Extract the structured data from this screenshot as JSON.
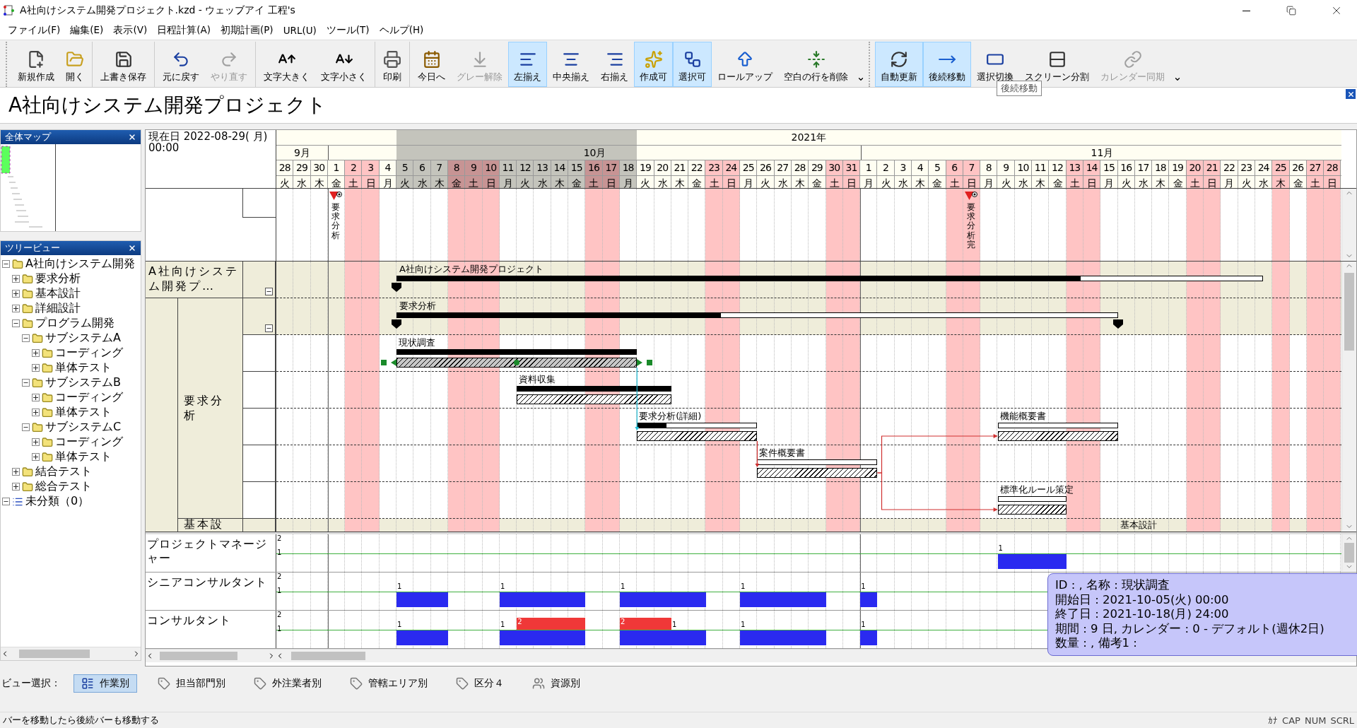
{
  "window": {
    "title": "A社向けシステム開発プロジェクト.kzd - ウェッブアイ 工程's"
  },
  "menu": [
    "ファイル(F)",
    "編集(E)",
    "表示(V)",
    "日程計算(A)",
    "初期計画(P)",
    "URL(U)",
    "ツール(T)",
    "ヘルプ(H)"
  ],
  "toolbars": [
    {
      "more": true,
      "groups": [
        [
          {
            "label": "新規作成",
            "disabled": false,
            "selected": false
          },
          {
            "label": "開く",
            "disabled": false,
            "selected": false
          }
        ],
        [
          {
            "label": "上書き保存",
            "disabled": false,
            "selected": false
          }
        ],
        [
          {
            "label": "元に戻す",
            "disabled": false,
            "selected": false
          },
          {
            "label": "やり直す",
            "disabled": true,
            "selected": false
          }
        ],
        [
          {
            "label": "文字大きく",
            "disabled": false,
            "selected": false
          },
          {
            "label": "文字小さく",
            "disabled": false,
            "selected": false
          }
        ],
        [
          {
            "label": "印刷",
            "disabled": false,
            "selected": false
          }
        ],
        [
          {
            "label": "今日へ",
            "disabled": false,
            "selected": false
          },
          {
            "label": "グレー解除",
            "disabled": true,
            "selected": false
          },
          {
            "label": "左揃え",
            "disabled": false,
            "selected": true
          },
          {
            "label": "中央揃え",
            "disabled": false,
            "selected": false
          },
          {
            "label": "右揃え",
            "disabled": false,
            "selected": false
          },
          {
            "label": "作成可",
            "disabled": false,
            "selected": true
          },
          {
            "label": "選択可",
            "disabled": false,
            "selected": true
          },
          {
            "label": "ロールアップ",
            "disabled": false,
            "selected": false
          },
          {
            "label": "空白の行を削除",
            "disabled": false,
            "selected": false
          }
        ]
      ]
    },
    {
      "more": true,
      "groups": [
        [
          {
            "label": "自動更新",
            "disabled": false,
            "selected": true
          },
          {
            "label": "後続移動",
            "disabled": false,
            "selected": true
          },
          {
            "label": "選択切換",
            "disabled": false,
            "selected": false
          },
          {
            "label": "スクリーン分割",
            "disabled": false,
            "selected": false
          },
          {
            "label": "カレンダー同期",
            "disabled": true,
            "selected": false
          }
        ]
      ]
    }
  ],
  "button_tooltip": "後続移動",
  "document_title": "A社向けシステム開発プロジェクト",
  "overview_map": {
    "title": "全体マップ"
  },
  "tree": {
    "title": "ツリービュー",
    "items": [
      {
        "label": "A社向けシステム開発",
        "kind": "folder",
        "expanded": true,
        "children": [
          {
            "label": "要求分析",
            "kind": "folder",
            "expanded": false
          },
          {
            "label": "基本設計",
            "kind": "folder",
            "expanded": false
          },
          {
            "label": "詳細設計",
            "kind": "folder",
            "expanded": false
          },
          {
            "label": "プログラム開発",
            "kind": "folder",
            "expanded": true,
            "children": [
              {
                "label": "サブシステムA",
                "kind": "folder",
                "expanded": true,
                "children": [
                  {
                    "label": "コーディング",
                    "kind": "folder",
                    "expanded": false
                  },
                  {
                    "label": "単体テスト",
                    "kind": "folder",
                    "expanded": false
                  }
                ]
              },
              {
                "label": "サブシステムB",
                "kind": "folder",
                "expanded": true,
                "children": [
                  {
                    "label": "コーディング",
                    "kind": "folder",
                    "expanded": false
                  },
                  {
                    "label": "単体テスト",
                    "kind": "folder",
                    "expanded": false
                  }
                ]
              },
              {
                "label": "サブシステムC",
                "kind": "folder",
                "expanded": true,
                "children": [
                  {
                    "label": "コーディング",
                    "kind": "folder",
                    "expanded": false
                  },
                  {
                    "label": "単体テスト",
                    "kind": "folder",
                    "expanded": false
                  }
                ]
              }
            ]
          },
          {
            "label": "結合テスト",
            "kind": "folder",
            "expanded": false
          },
          {
            "label": "総合テスト",
            "kind": "folder",
            "expanded": false
          }
        ]
      },
      {
        "label": "未分類（0）",
        "kind": "list",
        "expanded": true
      }
    ]
  },
  "current_date": "現在日 2022-08-29( 月) 00:00",
  "timeline": {
    "year": "2021年",
    "months": [
      {
        "label": "9月",
        "days": [
          {
            "day": "28",
            "weekday": "火",
            "kind": "weekday",
            "selected": false
          },
          {
            "day": "29",
            "weekday": "水",
            "kind": "weekday",
            "selected": false
          },
          {
            "day": "30",
            "weekday": "木",
            "kind": "weekday",
            "selected": false
          }
        ]
      },
      {
        "label": "10月",
        "days": [
          {
            "day": "1",
            "weekday": "金",
            "kind": "weekday",
            "selected": false
          },
          {
            "day": "2",
            "weekday": "土",
            "kind": "holiday",
            "selected": false
          },
          {
            "day": "3",
            "weekday": "日",
            "kind": "holiday",
            "selected": false
          },
          {
            "day": "4",
            "weekday": "月",
            "kind": "weekday",
            "selected": false
          },
          {
            "day": "5",
            "weekday": "火",
            "kind": "weekday",
            "selected": true
          },
          {
            "day": "6",
            "weekday": "水",
            "kind": "weekday",
            "selected": true
          },
          {
            "day": "7",
            "weekday": "木",
            "kind": "weekday",
            "selected": true
          },
          {
            "day": "8",
            "weekday": "金",
            "kind": "holiday",
            "selected": true
          },
          {
            "day": "9",
            "weekday": "土",
            "kind": "holiday",
            "selected": true
          },
          {
            "day": "10",
            "weekday": "日",
            "kind": "holiday",
            "selected": true
          },
          {
            "day": "11",
            "weekday": "月",
            "kind": "weekday",
            "selected": true
          },
          {
            "day": "12",
            "weekday": "火",
            "kind": "weekday",
            "selected": true
          },
          {
            "day": "13",
            "weekday": "水",
            "kind": "weekday",
            "selected": true
          },
          {
            "day": "14",
            "weekday": "木",
            "kind": "weekday",
            "selected": true
          },
          {
            "day": "15",
            "weekday": "金",
            "kind": "weekday",
            "selected": true
          },
          {
            "day": "16",
            "weekday": "土",
            "kind": "holiday",
            "selected": true
          },
          {
            "day": "17",
            "weekday": "日",
            "kind": "holiday",
            "selected": true
          },
          {
            "day": "18",
            "weekday": "月",
            "kind": "weekday",
            "selected": true
          },
          {
            "day": "19",
            "weekday": "火",
            "kind": "weekday",
            "selected": false
          },
          {
            "day": "20",
            "weekday": "水",
            "kind": "weekday",
            "selected": false
          },
          {
            "day": "21",
            "weekday": "木",
            "kind": "weekday",
            "selected": false
          },
          {
            "day": "22",
            "weekday": "金",
            "kind": "weekday",
            "selected": false
          },
          {
            "day": "23",
            "weekday": "土",
            "kind": "holiday",
            "selected": false
          },
          {
            "day": "24",
            "weekday": "日",
            "kind": "holiday",
            "selected": false
          },
          {
            "day": "25",
            "weekday": "月",
            "kind": "weekday",
            "selected": false
          },
          {
            "day": "26",
            "weekday": "火",
            "kind": "weekday",
            "selected": false
          },
          {
            "day": "27",
            "weekday": "水",
            "kind": "weekday",
            "selected": false
          },
          {
            "day": "28",
            "weekday": "木",
            "kind": "weekday",
            "selected": false
          },
          {
            "day": "29",
            "weekday": "金",
            "kind": "weekday",
            "selected": false
          },
          {
            "day": "30",
            "weekday": "土",
            "kind": "holiday",
            "selected": false
          },
          {
            "day": "31",
            "weekday": "日",
            "kind": "holiday",
            "selected": false
          }
        ]
      },
      {
        "label": "11月",
        "days": [
          {
            "day": "1",
            "weekday": "月",
            "kind": "weekday",
            "selected": false
          },
          {
            "day": "2",
            "weekday": "火",
            "kind": "weekday",
            "selected": false
          },
          {
            "day": "3",
            "weekday": "水",
            "kind": "weekday",
            "selected": false
          },
          {
            "day": "4",
            "weekday": "木",
            "kind": "weekday",
            "selected": false
          },
          {
            "day": "5",
            "weekday": "金",
            "kind": "weekday",
            "selected": false
          },
          {
            "day": "6",
            "weekday": "土",
            "kind": "holiday",
            "selected": false
          },
          {
            "day": "7",
            "weekday": "日",
            "kind": "holiday",
            "selected": false
          },
          {
            "day": "8",
            "weekday": "月",
            "kind": "weekday",
            "selected": false
          },
          {
            "day": "9",
            "weekday": "火",
            "kind": "weekday",
            "selected": false
          },
          {
            "day": "10",
            "weekday": "水",
            "kind": "weekday",
            "selected": false
          },
          {
            "day": "11",
            "weekday": "木",
            "kind": "weekday",
            "selected": false
          },
          {
            "day": "12",
            "weekday": "金",
            "kind": "weekday",
            "selected": false
          },
          {
            "day": "13",
            "weekday": "土",
            "kind": "holiday",
            "selected": false
          },
          {
            "day": "14",
            "weekday": "日",
            "kind": "holiday",
            "selected": false
          },
          {
            "day": "15",
            "weekday": "月",
            "kind": "weekday",
            "selected": false
          },
          {
            "day": "16",
            "weekday": "火",
            "kind": "weekday",
            "selected": false
          },
          {
            "day": "17",
            "weekday": "水",
            "kind": "weekday",
            "selected": false
          },
          {
            "day": "18",
            "weekday": "木",
            "kind": "weekday",
            "selected": false
          },
          {
            "day": "19",
            "weekday": "金",
            "kind": "weekday",
            "selected": false
          },
          {
            "day": "20",
            "weekday": "土",
            "kind": "holiday",
            "selected": false
          },
          {
            "day": "21",
            "weekday": "日",
            "kind": "holiday",
            "selected": false
          },
          {
            "day": "22",
            "weekday": "月",
            "kind": "weekday",
            "selected": false
          },
          {
            "day": "23",
            "weekday": "火",
            "kind": "weekday",
            "selected": false
          },
          {
            "day": "24",
            "weekday": "水",
            "kind": "weekday",
            "selected": false
          },
          {
            "day": "25",
            "weekday": "木",
            "kind": "holiday",
            "selected": false
          },
          {
            "day": "26",
            "weekday": "金",
            "kind": "weekday",
            "selected": false
          },
          {
            "day": "27",
            "weekday": "土",
            "kind": "holiday",
            "selected": false
          },
          {
            "day": "28",
            "weekday": "日",
            "kind": "holiday",
            "selected": false
          }
        ]
      }
    ]
  },
  "milestones": [
    {
      "label": "要求分析"
    },
    {
      "label": "要求分析完"
    }
  ],
  "task_area": {
    "project_label": "A社向けシステム開発プ…",
    "group_label": "要求分析",
    "rows": [
      {
        "kind": "summary",
        "expanded": true,
        "bars": [
          {
            "label": "A社向けシステム開発プロジェクト",
            "level": 0.79,
            "continues": true
          }
        ]
      },
      {
        "kind": "summary",
        "expanded": true,
        "bars": [
          {
            "label": "要求分析",
            "level": 0.45,
            "continues": false
          }
        ]
      },
      {
        "kind": "task",
        "bars": [
          {
            "label": "現状調査",
            "level": 1,
            "selected": true
          }
        ]
      },
      {
        "kind": "task",
        "bars": [
          {
            "label": "資料収集",
            "level": 1,
            "selected": false
          }
        ]
      },
      {
        "kind": "task",
        "bars": [
          {
            "label": "要求分析(詳細)",
            "level": 0.24,
            "selected": false
          },
          {
            "label": "機能概要書",
            "level": 0,
            "selected": false
          }
        ]
      },
      {
        "kind": "task",
        "bars": [
          {
            "label": "案件概要書",
            "level": 0,
            "selected": false
          }
        ]
      },
      {
        "kind": "task",
        "bars": [
          {
            "label": "標準化ルール策定",
            "level": 0,
            "selected": false
          }
        ]
      }
    ],
    "next_group": {
      "label": "基本設",
      "bar_label": "基本設計"
    }
  },
  "resources": [
    {
      "label": "プロジェクトマネージャー",
      "scale": [
        "2",
        "1"
      ],
      "bars": [
        {
          "kind": "base"
        }
      ],
      "marks": [
        {
          "text": "1",
          "kind": "base"
        }
      ]
    },
    {
      "label": "シニアコンサルタント",
      "scale": [
        "2",
        "1"
      ],
      "bars": [
        {
          "kind": "base"
        },
        {
          "kind": "base"
        },
        {
          "kind": "base"
        },
        {
          "kind": "base"
        },
        {
          "kind": "base"
        }
      ],
      "marks": [
        {
          "text": "1",
          "kind": "base"
        },
        {
          "text": "1",
          "kind": "base"
        },
        {
          "text": "1",
          "kind": "base"
        },
        {
          "text": "1",
          "kind": "base"
        },
        {
          "text": "1",
          "kind": "base"
        }
      ]
    },
    {
      "label": "コンサルタント",
      "scale": [
        "2",
        "1"
      ],
      "bars": [
        {
          "kind": "base"
        },
        {
          "kind": "base"
        },
        {
          "kind": "peak"
        },
        {
          "kind": "base"
        },
        {
          "kind": "peak"
        },
        {
          "kind": "base"
        },
        {
          "kind": "base"
        }
      ],
      "marks": [
        {
          "text": "1",
          "kind": "base"
        },
        {
          "text": "1",
          "kind": "base"
        },
        {
          "text": "2",
          "kind": "peak"
        },
        {
          "text": "2",
          "kind": "peak"
        },
        {
          "text": "1",
          "kind": "base"
        },
        {
          "text": "1",
          "kind": "base"
        },
        {
          "text": "1",
          "kind": "base"
        }
      ]
    }
  ],
  "bar_tooltip": [
    "ID : , 名称 : 現状調査",
    "開始日 : 2021-10-05(火) 00:00",
    "終了日 : 2021-10-18(月) 24:00",
    "期間 : 9 日, カレンダー : 0 - デフォルト(週休2日)",
    "数量 : , 備考1 :"
  ],
  "view_selector": {
    "label": "ビュー選択：",
    "views": [
      {
        "label": "作業別",
        "selected": true
      },
      {
        "label": "担当部門別",
        "selected": false
      },
      {
        "label": "外注業者別",
        "selected": false
      },
      {
        "label": "管轄エリア別",
        "selected": false
      },
      {
        "label": "区分４",
        "selected": false
      },
      {
        "label": "資源別",
        "selected": false
      }
    ]
  },
  "status_bar": {
    "message": "バーを移動したら後続バーも移動する",
    "indicators": [
      "ｶﾅ",
      "CAP",
      "NUM",
      "SCRL"
    ]
  }
}
